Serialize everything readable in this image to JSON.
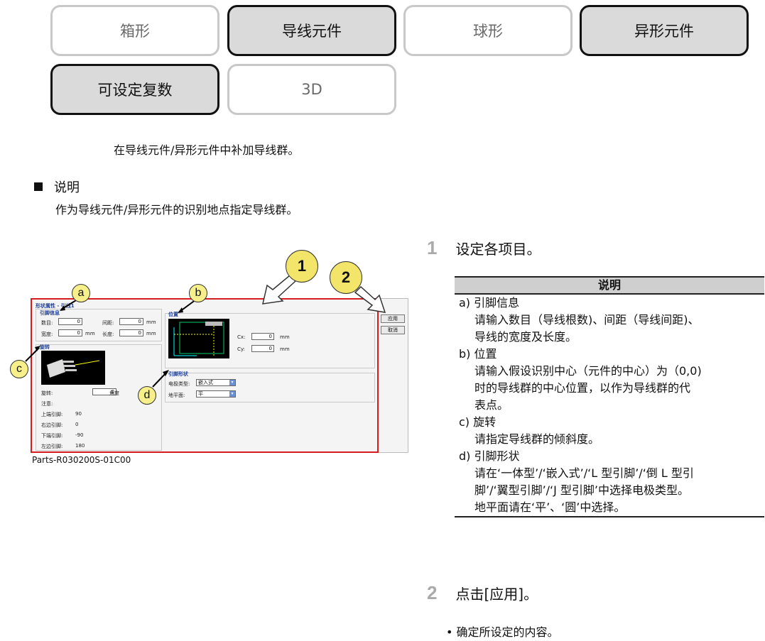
{
  "tabs": [
    {
      "label": "箱形",
      "active": false
    },
    {
      "label": "导线元件",
      "active": true
    },
    {
      "label": "球形",
      "active": false
    },
    {
      "label": "异形元件",
      "active": true
    },
    {
      "label": "可设定复数",
      "active": true
    },
    {
      "label": "3D",
      "active": false
    }
  ],
  "subtitle": "在导线元件/异形元件中补加导线群。",
  "section": {
    "heading": "说明",
    "body": "作为导线元件/异形元件的识别地点指定导线群。"
  },
  "figure": {
    "caption": "Parts-R030200S-01C00",
    "callouts": {
      "a": "a",
      "b": "b",
      "c": "c",
      "d": "d",
      "n1": "1",
      "n2": "2"
    },
    "dialog": {
      "title": "形状属性 - 引线1",
      "lead_info": "引脚信息",
      "count_label": "数目:",
      "count_value": "0",
      "pitch_label": "间距:",
      "pitch_value": "0",
      "pitch_unit": "mm",
      "width_label": "宽度:",
      "width_value": "0",
      "width_unit": "mm",
      "length_label": "长度:",
      "length_value": "0",
      "length_unit": "mm",
      "rotation_head": "旋转",
      "rotation_label": "旋转:",
      "rotation_value": "0",
      "rotation_unit": "角度",
      "note_label": "注意:",
      "up_label": "上端引脚:",
      "up_value": "90",
      "right_label": "右边引脚:",
      "right_value": "0",
      "down_label": "下端引脚:",
      "down_value": "-90",
      "left_label": "左边引脚:",
      "left_value": "180",
      "position_head": "位置",
      "cx_label": "Cx:",
      "cx_value": "0",
      "cx_unit": "mm",
      "cy_label": "Cy:",
      "cy_value": "0",
      "cy_unit": "mm",
      "shape_head": "引脚形状",
      "terminal_label": "电极类型:",
      "terminal_value": "嵌入式",
      "ground_label": "地平面:",
      "ground_value": "平",
      "apply": "应用",
      "cancel": "取消"
    }
  },
  "steps": [
    {
      "num": "1",
      "text": "设定各项目。"
    },
    {
      "num": "2",
      "text": "点击[应用]。"
    }
  ],
  "table": {
    "header": "说明",
    "items": [
      {
        "head": "a) 引脚信息",
        "lines": [
          "请输入数目（导线根数)、间距（导线间距)、",
          "导线的宽度及长度。"
        ]
      },
      {
        "head": "b) 位置",
        "lines": [
          "请输入假设识别中心（元件的中心）为（0,0)",
          "时的导线群的中心位置，以作为导线群的代",
          "表点。"
        ]
      },
      {
        "head": "c) 旋转",
        "lines": [
          "请指定导线群的倾斜度。"
        ]
      },
      {
        "head": "d) 引脚形状",
        "lines": [
          "请在‘一体型’/‘嵌入式’/‘L 型引脚’/‘倒 L 型引",
          "脚’/‘翼型引脚’/‘J 型引脚’中选择电极类型。",
          "地平面请在‘平’、‘圆’中选择。"
        ]
      }
    ]
  },
  "bullet": "• 确定所设定的内容。"
}
